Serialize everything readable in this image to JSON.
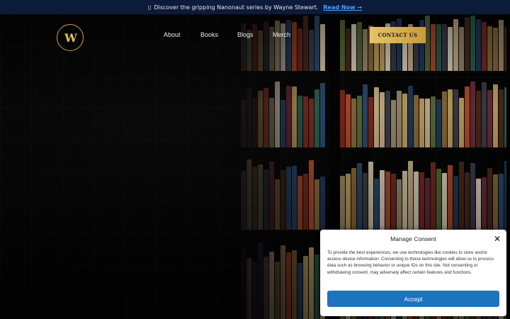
{
  "announcement": {
    "icon": "book-icon",
    "text": "Discover the gripping Nanonaut series by Wayne Stewart.",
    "link_label": "Read Now →"
  },
  "header": {
    "logo_text": "W",
    "nav": [
      "About",
      "Books",
      "Blogs",
      "Merch"
    ],
    "contact_label": "CONTACT US"
  },
  "consent": {
    "title": "Manage Consent",
    "body": "To provide the best experiences, we use technologies like cookies to store and/or access device information. Consenting to these technologies will allow us to process data such as browsing behavior or unique IDs on this site. Not consenting or withdrawing consent, may adversely affect certain features and functions.",
    "accept_label": "Accept",
    "close_icon": "close-icon"
  },
  "colors": {
    "announcement_bg": "#0d1b3a",
    "gold": "#d4aa50",
    "accept_blue": "#1e73be"
  }
}
